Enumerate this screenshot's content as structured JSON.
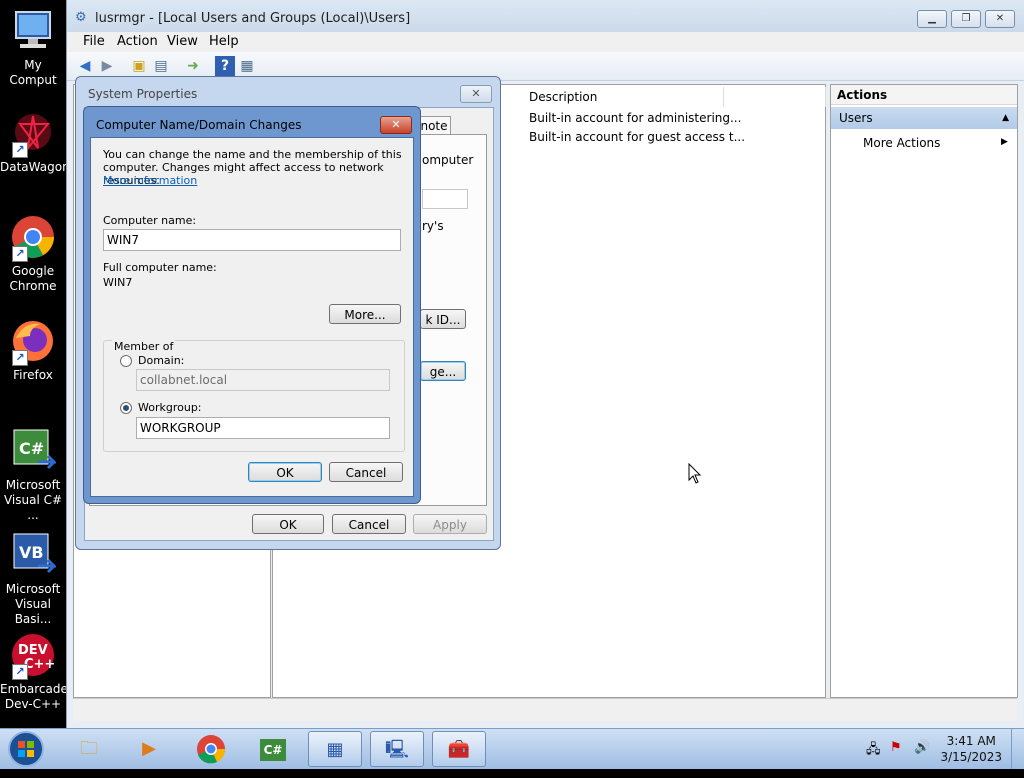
{
  "desktop": {
    "icons": [
      {
        "label": "My Comput",
        "icon": "computer-icon"
      },
      {
        "label": "DataWagon",
        "icon": "datawagon-icon"
      },
      {
        "label": "Google Chrome",
        "icon": "chrome-icon"
      },
      {
        "label": "Firefox",
        "icon": "firefox-icon"
      },
      {
        "label": "Microsoft Visual C# ...",
        "icon": "visual-csharp-icon"
      },
      {
        "label": "Microsoft Visual Basi...",
        "icon": "visual-basic-icon"
      },
      {
        "label": "Embarcade Dev-C++",
        "icon": "dev-cpp-icon"
      }
    ]
  },
  "window": {
    "title": "lusrmgr - [Local Users and Groups (Local)\\Users]",
    "menu": [
      "File",
      "Action",
      "View",
      "Help"
    ],
    "toolbar_icons": [
      "back-icon",
      "forward-icon",
      "up-folder-icon",
      "show-hide-tree-icon",
      "export-list-icon",
      "help-icon",
      "properties-icon"
    ]
  },
  "list": {
    "column_description": "Description",
    "rows": [
      "Built-in account for administering...",
      "Built-in account for guest access t..."
    ],
    "partial_labels": {
      "tab": "note",
      "computer": "omputer",
      "ys": "ry's",
      "network_id_btn": "k ID...",
      "change_btn": "ge..."
    }
  },
  "actions": {
    "header": "Actions",
    "section": "Users",
    "item": "More Actions"
  },
  "system_properties": {
    "title": "System Properties",
    "ok": "OK",
    "cancel": "Cancel",
    "apply": "Apply"
  },
  "computer_name_dialog": {
    "title": "Computer Name/Domain Changes",
    "intro": "You can change the name and the membership of this computer. Changes might affect access to network resources.",
    "more_info_link": "More information",
    "computer_name_label": "Computer name:",
    "computer_name_value": "WIN7",
    "full_name_label": "Full computer name:",
    "full_name_value": "WIN7",
    "more_button": "More...",
    "member_of_label": "Member of",
    "domain_label": "Domain:",
    "domain_value": "collabnet.local",
    "workgroup_label": "Workgroup:",
    "workgroup_value": "WORKGROUP",
    "ok": "OK",
    "cancel": "Cancel"
  },
  "taskbar": {
    "time": "3:41 AM",
    "date": "3/15/2023"
  }
}
